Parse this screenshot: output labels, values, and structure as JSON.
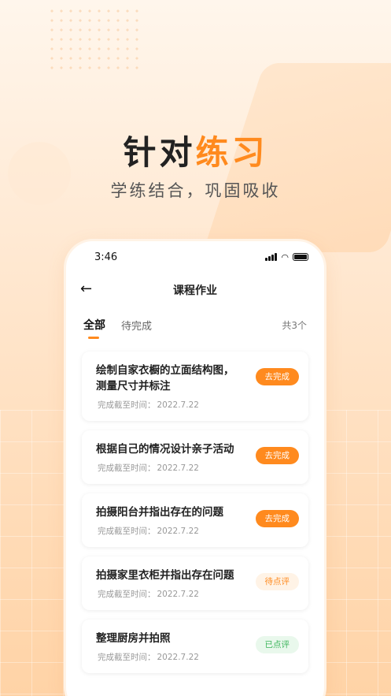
{
  "hero": {
    "title_main": "针对",
    "title_accent": "练习",
    "subtitle": "学练结合，巩固吸收"
  },
  "status_bar": {
    "time": "3:46"
  },
  "nav": {
    "back_icon": "arrow-left-icon",
    "title": "课程作业"
  },
  "tabs": [
    {
      "label": "全部",
      "active": true
    },
    {
      "label": "待完成",
      "active": false
    }
  ],
  "count_text": "共3个",
  "colors": {
    "accent": "#ff8a1e",
    "done": "#3cb55b"
  },
  "assignments": [
    {
      "title": "绘制自家衣橱的立面结构图，测量尺寸并标注",
      "date_label": "完成截至时间：",
      "date": "2022.7.22",
      "status": "去完成"
    },
    {
      "title": "根据自己的情况设计亲子活动",
      "date_label": "完成截至时间：",
      "date": "2022.7.22",
      "status": "去完成"
    },
    {
      "title": "拍摄阳台并指出存在的问题",
      "date_label": "完成截至时间：",
      "date": "2022.7.22",
      "status": "去完成"
    },
    {
      "title": "拍摄家里衣柜并指出存在问题",
      "date_label": "完成截至时间：",
      "date": "2022.7.22",
      "status": "待点评"
    },
    {
      "title": "整理厨房并拍照",
      "date_label": "完成截至时间：",
      "date": "2022.7.22",
      "status": "已点评"
    }
  ]
}
